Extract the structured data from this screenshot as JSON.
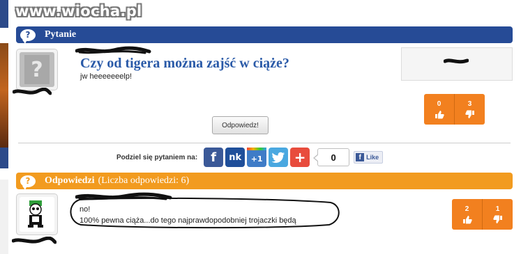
{
  "site": {
    "watermark": "www.wiocha.pl"
  },
  "question_header": {
    "icon": "?",
    "title": "Pytanie"
  },
  "question": {
    "title": "Czy od tigera można zajść w ciąże?",
    "body": "jw heeeeeeelp!",
    "votes_up": "0",
    "votes_down": "3",
    "answer_button": "Odpowiedz!"
  },
  "share": {
    "label": "Podziel się pytaniem na:",
    "icons": [
      "facebook-icon",
      "nk-icon",
      "google-plus-icon",
      "twitter-icon",
      "add-icon"
    ],
    "nk_label": "nk",
    "gplus_label": "+1",
    "plus_label": "+",
    "fb_label": "f",
    "count": "0",
    "like_label": "Like"
  },
  "answers_header": {
    "icon": "?",
    "title": "Odpowiedzi",
    "count_text": "(Liczba odpowiedzi: 6)"
  },
  "answers": [
    {
      "line1": "no!",
      "line2": "100% pewna ciąża...do tego najprawdopodobniej trojaczki będą",
      "votes_up": "2",
      "votes_down": "1"
    }
  ],
  "colors": {
    "blue_bar": "#264b96",
    "orange_bar": "#f29b1f",
    "vote_box": "#f2801f",
    "question_title": "#2a5aa8"
  }
}
